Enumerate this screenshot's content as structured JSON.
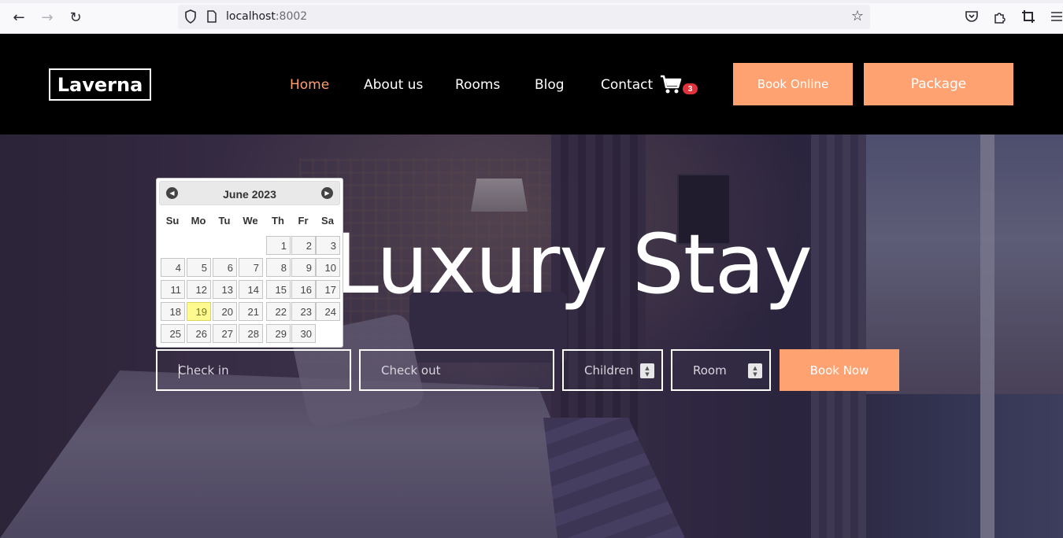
{
  "browser": {
    "url_host": "localhost",
    "url_port": ":8002"
  },
  "site": {
    "logo": "Laverna",
    "menu": [
      {
        "label": "Home",
        "active": true
      },
      {
        "label": "About us",
        "active": false
      },
      {
        "label": "Rooms",
        "active": false
      },
      {
        "label": "Blog",
        "active": false
      },
      {
        "label": "Contact",
        "active": false
      }
    ],
    "cart_count": "3",
    "book_online": "Book Online",
    "package": "Package"
  },
  "hero": {
    "title": "Luxury Stay"
  },
  "booking": {
    "checkin_placeholder": "Check in",
    "checkout_placeholder": "Check out",
    "children_placeholder": "Children",
    "room_placeholder": "Room",
    "book_now": "Book Now"
  },
  "datepicker": {
    "month_year": "June 2023",
    "weekdays": [
      "Su",
      "Mo",
      "Tu",
      "We",
      "Th",
      "Fr",
      "Sa"
    ],
    "first_weekday_index": 4,
    "days_in_month": 30,
    "today": 19
  },
  "colors": {
    "accent": "#ffa272",
    "active_menu": "#ff9f70",
    "header_bg": "#000000",
    "badge": "#e0323a",
    "today_highlight": "#fffa90"
  }
}
